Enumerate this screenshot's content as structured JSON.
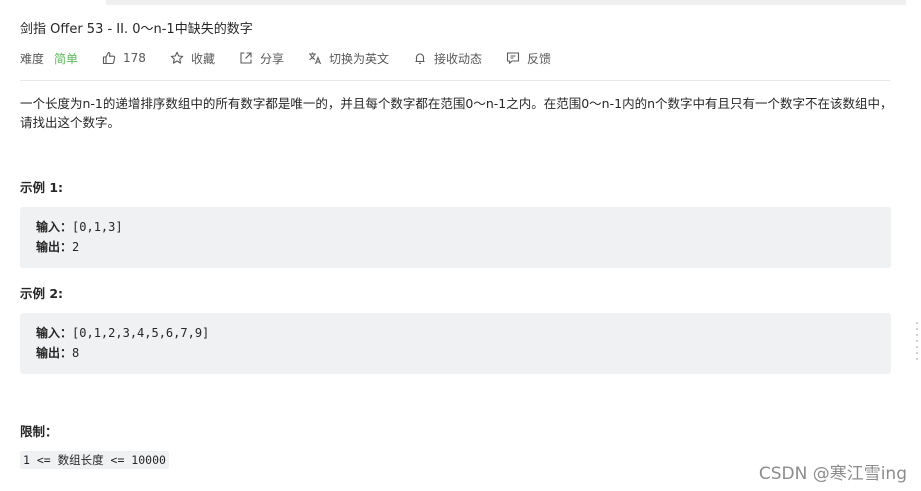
{
  "problem": {
    "title": "剑指 Offer 53 - II. 0～n-1中缺失的数字",
    "difficulty_label": "难度",
    "difficulty_value": "简单",
    "likes": "178",
    "favorite_label": "收藏",
    "share_label": "分享",
    "translate_label": "切换为英文",
    "notify_label": "接收动态",
    "feedback_label": "反馈",
    "description": "一个长度为n-1的递增排序数组中的所有数字都是唯一的，并且每个数字都在范围0～n-1之内。在范围0～n-1内的n个数字中有且只有一个数字不在该数组中，请找出这个数字。"
  },
  "examples": [
    {
      "heading": "示例 1:",
      "input_key": "输入：",
      "input_value": "[0,1,3]",
      "output_key": "输出：",
      "output_value": "2"
    },
    {
      "heading": "示例 2:",
      "input_key": "输入：",
      "input_value": "[0,1,2,3,4,5,6,7,9]",
      "output_key": "输出：",
      "output_value": "8"
    }
  ],
  "constraints": {
    "heading": "限制：",
    "items": [
      "1 <= 数组长度 <= 10000"
    ]
  },
  "watermark": "CSDN @寒江雪ing",
  "colors": {
    "easy": "#5cb85c",
    "code_bg": "#f0f1f3"
  },
  "icons": {
    "like": "thumbs-up-icon",
    "favorite": "star-icon",
    "share": "share-icon",
    "translate": "translate-icon",
    "notify": "bell-icon",
    "feedback": "feedback-icon"
  }
}
